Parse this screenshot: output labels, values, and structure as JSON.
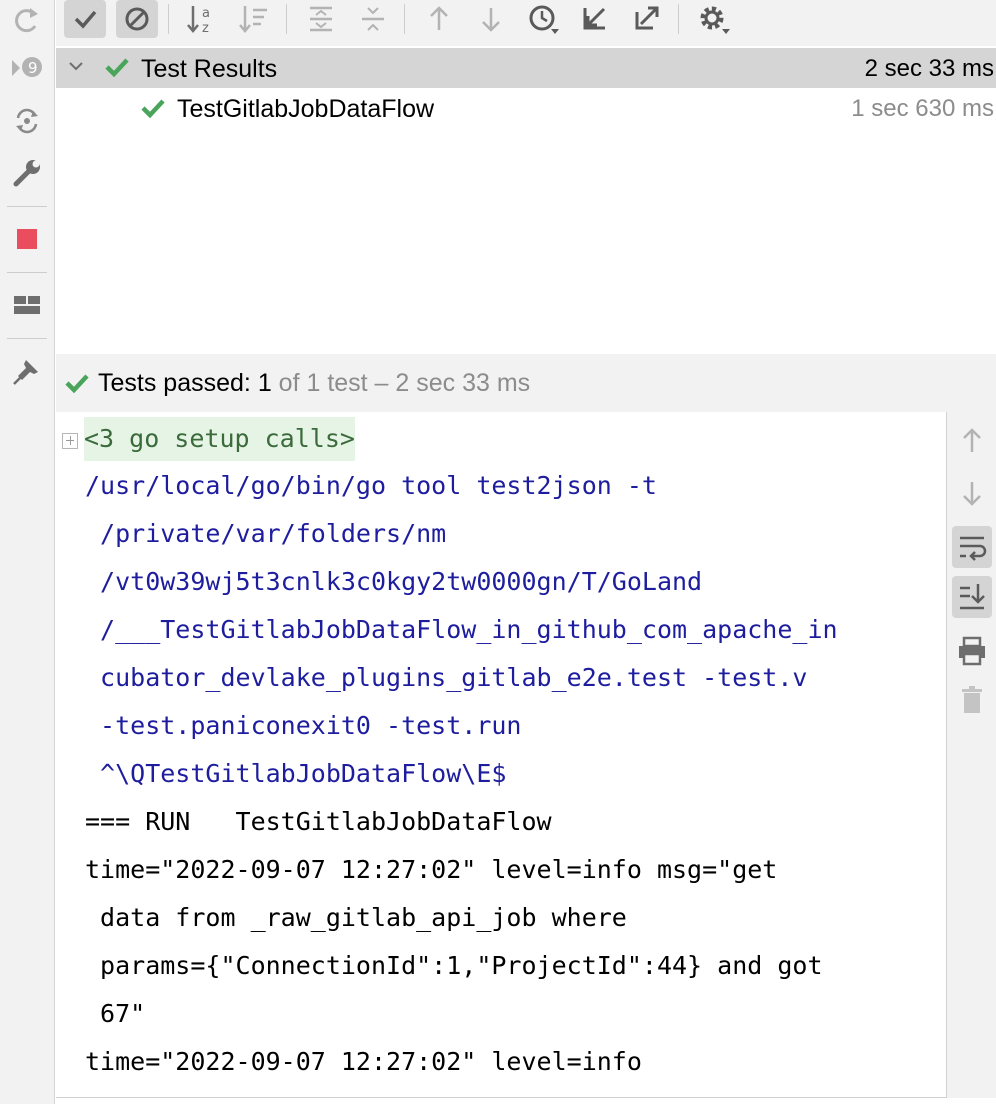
{
  "tree": {
    "root": {
      "label": "Test Results",
      "duration": "2 sec 33 ms",
      "status": "passed"
    },
    "children": [
      {
        "label": "TestGitlabJobDataFlow",
        "duration": "1 sec 630 ms",
        "status": "passed"
      }
    ]
  },
  "status_bar": {
    "prefix": "Tests passed:",
    "passed_count": "1",
    "suffix": "of 1 test – 2 sec 33 ms"
  },
  "console": {
    "fold_label": "<3 go setup calls>",
    "lines": [
      {
        "text": "/usr/local/go/bin/go tool test2json -t",
        "style": "blue"
      },
      {
        "text": " /private/var/folders/nm",
        "style": "blue"
      },
      {
        "text": " /vt0w39wj5t3cnlk3c0kgy2tw0000gn/T/GoLand",
        "style": "blue"
      },
      {
        "text": " /___TestGitlabJobDataFlow_in_github_com_apache_in",
        "style": "blue"
      },
      {
        "text": " cubator_devlake_plugins_gitlab_e2e.test -test.v",
        "style": "blue"
      },
      {
        "text": " -test.paniconexit0 -test.run",
        "style": "blue"
      },
      {
        "text": " ^\\QTestGitlabJobDataFlow\\E$",
        "style": "blue"
      },
      {
        "text": "=== RUN   TestGitlabJobDataFlow",
        "style": "black"
      },
      {
        "text": "time=\"2022-09-07 12:27:02\" level=info msg=\"get",
        "style": "black"
      },
      {
        "text": " data from _raw_gitlab_api_job where",
        "style": "black"
      },
      {
        "text": " params={\"ConnectionId\":1,\"ProjectId\":44} and got",
        "style": "black"
      },
      {
        "text": " 67\"",
        "style": "black"
      },
      {
        "text": "time=\"2022-09-07 12:27:02\" level=info",
        "style": "black"
      }
    ]
  },
  "icons": {
    "left_toolbar": [
      "rerun-icon",
      "rerun-failed-icon",
      "toggle-auto-test-icon",
      "settings-wrench-icon",
      "stop-icon",
      "layout-icon",
      "pin-icon"
    ],
    "top_toolbar": [
      "show-passed-icon",
      "show-ignored-icon",
      "sort-alphabetically-icon",
      "sort-by-duration-icon",
      "expand-all-icon",
      "collapse-all-icon",
      "previous-failed-icon",
      "next-failed-icon",
      "test-history-icon",
      "import-tests-icon",
      "export-tests-icon",
      "settings-gear-icon"
    ],
    "console_toolbar": [
      "scroll-up-icon",
      "scroll-down-icon",
      "soft-wrap-icon",
      "scroll-to-end-icon",
      "print-icon",
      "clear-all-icon"
    ]
  },
  "colors": {
    "pass_green": "#4aa55a",
    "stop_red": "#ea4e5e",
    "console_blue": "#1d1d9e",
    "muted_gray": "#8c8c8c"
  }
}
